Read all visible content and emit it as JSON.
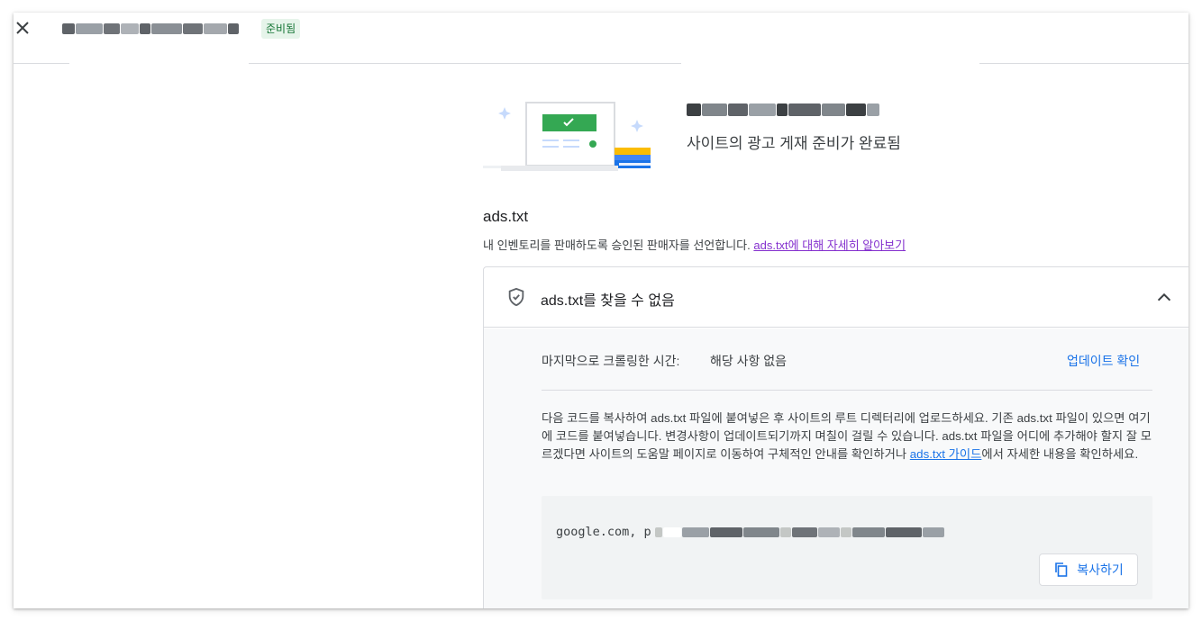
{
  "header": {
    "close_icon": "close-icon",
    "status_badge": "준비됨"
  },
  "hero": {
    "subtitle": "사이트의 광고 게재 준비가 완료됨"
  },
  "ads_txt": {
    "title": "ads.txt",
    "description": "내 인벤토리를 판매하도록 승인된 판매자를 선언합니다. ",
    "learn_more_link": "ads.txt에 대해 자세히 알아보기",
    "panel": {
      "status_icon": "shield-check-icon",
      "title": "ads.txt를 찾을 수 없음",
      "expanded": true,
      "last_crawled_label": "마지막으로 크롤링한 시간:",
      "last_crawled_value": "해당 사항 없음",
      "check_update_link": "업데이트 확인",
      "instructions_text": "다음 코드를 복사하여 ads.txt 파일에 붙여넣은 후 사이트의 루트 디렉터리에 업로드하세요. 기존 ads.txt 파일이 있으면 여기에 코드를 붙여넣습니다. 변경사항이 업데이트되기까지 며칠이 걸릴 수 있습니다. ads.txt 파일을 어디에 추가해야 할지 잘 모르겠다면 사이트의 도움말 페이지로 이동하여 구체적인 안내를 확인하거나 ",
      "guide_link": "ads.txt 가이드",
      "instructions_tail": "에서 자세한 내용을 확인하세요.",
      "code_prefix": "google.com, p",
      "copy_button": "복사하기"
    }
  },
  "colors": {
    "accent": "#1a73e8",
    "visited_link": "#8430ce",
    "ready_badge_bg": "#e6f4ea",
    "ready_badge_text": "#137333"
  }
}
